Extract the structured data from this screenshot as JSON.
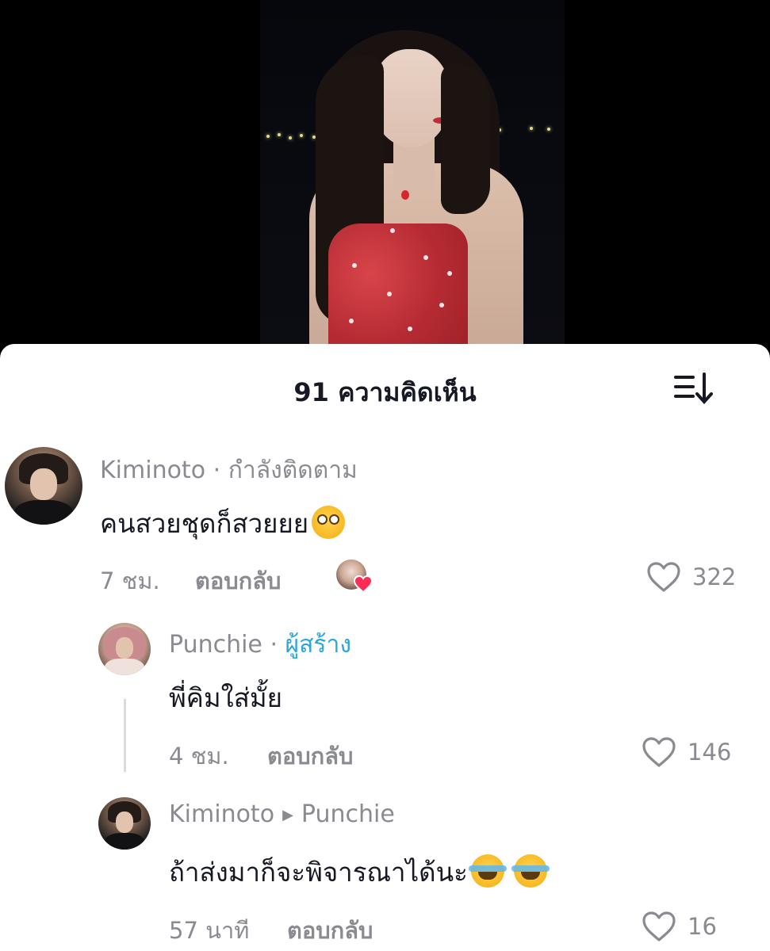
{
  "sheet": {
    "title": "91 ความคิดเห็น",
    "sort_icon": "sort-descending-icon"
  },
  "comments": [
    {
      "username": "Kiminoto",
      "separator": "·",
      "relation": "กำลังติดตาม",
      "text": "คนสวยชุดก็สวยยย",
      "emoji": [
        "flushed-face"
      ],
      "time": "7 ชม.",
      "reply_label": "ตอบกลับ",
      "liked_by_creator": true,
      "likes": "322"
    },
    {
      "username": "Punchie",
      "separator": "·",
      "relation": "ผู้สร้าง",
      "text": "พี่คิมใส่มั้ย",
      "time": "4 ชม.",
      "reply_label": "ตอบกลับ",
      "likes": "146"
    },
    {
      "username": "Kiminoto",
      "reply_to": "Punchie",
      "text": "ถ้าส่งมาก็จะพิจารณาได้นะ",
      "emoji": [
        "face-with-tears-of-joy",
        "face-with-tears-of-joy"
      ],
      "time": "57 นาที",
      "reply_label": "ตอบกลับ",
      "likes": "16"
    }
  ],
  "colors": {
    "creator_label": "#2aa6d9",
    "muted_text": "#8a8b91",
    "primary_text": "#161823",
    "liked_heart": "#fe2c55"
  }
}
